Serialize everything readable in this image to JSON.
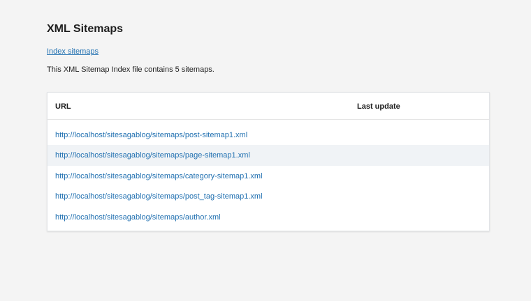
{
  "page": {
    "title": "XML Sitemaps",
    "index_link": "Index sitemaps",
    "description": "This XML Sitemap Index file contains 5 sitemaps."
  },
  "table": {
    "headers": {
      "url": "URL",
      "last_update": "Last update"
    },
    "rows": [
      {
        "url": "http://localhost/sitesagablog/sitemaps/post-sitemap1.xml",
        "last_update": ""
      },
      {
        "url": "http://localhost/sitesagablog/sitemaps/page-sitemap1.xml",
        "last_update": ""
      },
      {
        "url": "http://localhost/sitesagablog/sitemaps/category-sitemap1.xml",
        "last_update": ""
      },
      {
        "url": "http://localhost/sitesagablog/sitemaps/post_tag-sitemap1.xml",
        "last_update": ""
      },
      {
        "url": "http://localhost/sitesagablog/sitemaps/author.xml",
        "last_update": ""
      }
    ]
  },
  "colors": {
    "background": "#f4f4f4",
    "link": "#2271b1",
    "row_alt": "#f0f3f6",
    "text": "#1e1e1e"
  }
}
